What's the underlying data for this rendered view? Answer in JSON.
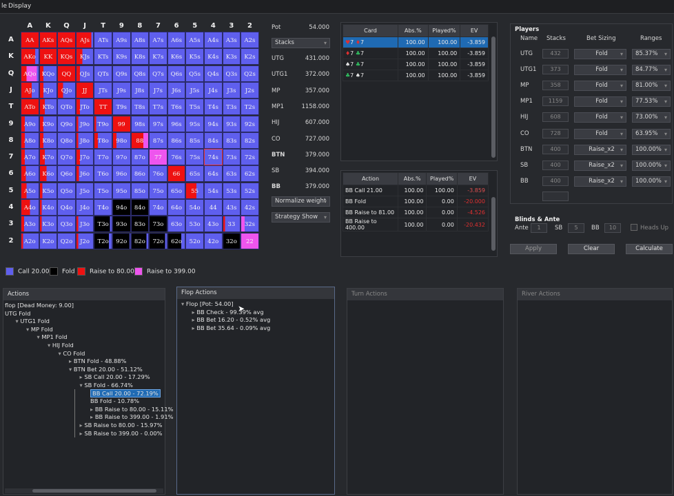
{
  "menu": {
    "file": "le",
    "display": "Display"
  },
  "ranks": [
    "A",
    "K",
    "Q",
    "J",
    "T",
    "9",
    "8",
    "7",
    "6",
    "5",
    "4",
    "3",
    "2"
  ],
  "cells": [
    [
      "AA",
      "AKs",
      "AQs",
      "AJs",
      "ATs",
      "A9s",
      "A8s",
      "A7s",
      "A6s",
      "A5s",
      "A4s",
      "A3s",
      "A2s"
    ],
    [
      "AKo",
      "KK",
      "KQs",
      "KJs",
      "KTs",
      "K9s",
      "K8s",
      "K7s",
      "K6s",
      "K5s",
      "K4s",
      "K3s",
      "K2s"
    ],
    [
      "AQo",
      "KQo",
      "QQ",
      "QJs",
      "QTs",
      "Q9s",
      "Q8s",
      "Q7s",
      "Q6s",
      "Q5s",
      "Q4s",
      "Q3s",
      "Q2s"
    ],
    [
      "AJo",
      "KJo",
      "QJo",
      "JJ",
      "JTs",
      "J9s",
      "J8s",
      "J7s",
      "J6s",
      "J5s",
      "J4s",
      "J3s",
      "J2s"
    ],
    [
      "ATo",
      "KTo",
      "QTo",
      "JTo",
      "TT",
      "T9s",
      "T8s",
      "T7s",
      "T6s",
      "T5s",
      "T4s",
      "T3s",
      "T2s"
    ],
    [
      "A9o",
      "K9o",
      "Q9o",
      "J9o",
      "T9o",
      "99",
      "98s",
      "97s",
      "96s",
      "95s",
      "94s",
      "93s",
      "92s"
    ],
    [
      "A8o",
      "K8o",
      "Q8o",
      "J8o",
      "T8o",
      "98o",
      "88",
      "87s",
      "86s",
      "85s",
      "84s",
      "83s",
      "82s"
    ],
    [
      "A7o",
      "K7o",
      "Q7o",
      "J7o",
      "T7o",
      "97o",
      "87o",
      "77",
      "76s",
      "75s",
      "74s",
      "73s",
      "72s"
    ],
    [
      "A6o",
      "K6o",
      "Q6o",
      "J6o",
      "T6o",
      "96o",
      "86o",
      "76o",
      "66",
      "65s",
      "64s",
      "63s",
      "62s"
    ],
    [
      "A5o",
      "K5o",
      "Q5o",
      "J5o",
      "T5o",
      "95o",
      "85o",
      "75o",
      "65o",
      "55",
      "54s",
      "53s",
      "52s"
    ],
    [
      "A4o",
      "K4o",
      "Q4o",
      "J4o",
      "T4o",
      "94o",
      "84o",
      "74o",
      "64o",
      "54o",
      "44",
      "43s",
      "42s"
    ],
    [
      "A3o",
      "K3o",
      "Q3o",
      "J3o",
      "T3o",
      "93o",
      "83o",
      "73o",
      "63o",
      "53o",
      "43o",
      "33",
      "32s"
    ],
    [
      "A2o",
      "K2o",
      "Q2o",
      "J2o",
      "T2o",
      "92o",
      "82o",
      "72o",
      "62o",
      "52o",
      "42o",
      "32o",
      "22"
    ]
  ],
  "colors": {
    "call": "#5f5fee",
    "fold": "#000000",
    "raise80": "#ee1111",
    "raise399": "#ee55ee"
  },
  "legend": [
    {
      "label": "Call 20.00",
      "color": "#5f5fee"
    },
    {
      "label": "Fold",
      "color": "#000000"
    },
    {
      "label": "Raise to 80.00",
      "color": "#ee1111"
    },
    {
      "label": "Raise to 399.00",
      "color": "#ee55ee"
    }
  ],
  "info": {
    "pot_label": "Pot",
    "pot_value": "54.000",
    "stacks_select": "Stacks",
    "players": [
      {
        "name": "UTG",
        "value": "431.000",
        "bold": false
      },
      {
        "name": "UTG1",
        "value": "372.000",
        "bold": false
      },
      {
        "name": "MP",
        "value": "357.000",
        "bold": false
      },
      {
        "name": "MP1",
        "value": "1158.000",
        "bold": false
      },
      {
        "name": "HIJ",
        "value": "607.000",
        "bold": false
      },
      {
        "name": "CO",
        "value": "727.000",
        "bold": false
      },
      {
        "name": "BTN",
        "value": "379.000",
        "bold": true
      },
      {
        "name": "SB",
        "value": "394.000",
        "bold": false
      },
      {
        "name": "BB",
        "value": "379.000",
        "bold": true
      }
    ],
    "normalize_select": "Normalize weight",
    "strategy_select": "Strategy Show"
  },
  "card_table": {
    "headers": [
      "Card",
      "Abs.%",
      "Played%",
      "EV"
    ],
    "rows": [
      {
        "card": "♥7 ♦7",
        "abs": "100.00",
        "played": "100.00",
        "ev": "-3.859"
      },
      {
        "card": "♦7 ♣7",
        "abs": "100.00",
        "played": "100.00",
        "ev": "-3.859"
      },
      {
        "card": "♠7 ♣7",
        "abs": "100.00",
        "played": "100.00",
        "ev": "-3.859"
      },
      {
        "card": "♣7 ♠7",
        "abs": "100.00",
        "played": "100.00",
        "ev": "-3.859"
      }
    ]
  },
  "action_table": {
    "headers": [
      "Action",
      "Abs.%",
      "Played%",
      "EV"
    ],
    "rows": [
      {
        "action": "BB Call 21.00",
        "abs": "100.00",
        "played": "100.00",
        "ev": "-3.859"
      },
      {
        "action": "BB Fold",
        "abs": "100.00",
        "played": "0.00",
        "ev": "-20.000"
      },
      {
        "action": "BB Raise to 81.00",
        "abs": "100.00",
        "played": "0.00",
        "ev": "-4.526"
      },
      {
        "action": "BB Raise to 400.00",
        "abs": "100.00",
        "played": "0.00",
        "ev": "-20.432"
      }
    ]
  },
  "players_panel": {
    "title": "Players",
    "headers": [
      "Name",
      "Stacks",
      "Bet Sizing",
      "Ranges"
    ],
    "rows": [
      {
        "name": "UTG",
        "stack": "432",
        "sizing": "Fold",
        "range": "85.37%"
      },
      {
        "name": "UTG1",
        "stack": "373",
        "sizing": "Fold",
        "range": "84.77%"
      },
      {
        "name": "MP",
        "stack": "358",
        "sizing": "Fold",
        "range": "81.00%"
      },
      {
        "name": "MP1",
        "stack": "1159",
        "sizing": "Fold",
        "range": "77.53%"
      },
      {
        "name": "HIJ",
        "stack": "608",
        "sizing": "Fold",
        "range": "73.00%"
      },
      {
        "name": "CO",
        "stack": "728",
        "sizing": "Fold",
        "range": "63.95%"
      },
      {
        "name": "BTN",
        "stack": "400",
        "sizing": "Raise_x2",
        "range": "100.00%"
      },
      {
        "name": "SB",
        "stack": "400",
        "sizing": "Raise_x2",
        "range": "100.00%"
      },
      {
        "name": "BB",
        "stack": "400",
        "sizing": "Raise_x2",
        "range": "100.00%"
      }
    ]
  },
  "blinds": {
    "title": "Blinds & Ante",
    "ante_label": "Ante",
    "ante": "1",
    "sb_label": "SB",
    "sb": "5",
    "bb_label": "BB",
    "bb": "10",
    "heads_up": "Heads Up"
  },
  "buttons": {
    "apply": "Apply",
    "clear": "Clear",
    "calculate": "Calculate"
  },
  "actions_panel": {
    "title": "Actions",
    "items": [
      {
        "text": "flop [Dead Money: 9.00]",
        "depth": 0,
        "arrow": ""
      },
      {
        "text": "UTG Fold",
        "depth": 0,
        "arrow": ""
      },
      {
        "text": "UTG1 Fold",
        "depth": 1,
        "arrow": "▾"
      },
      {
        "text": "MP Fold",
        "depth": 2,
        "arrow": "▾"
      },
      {
        "text": "MP1 Fold",
        "depth": 3,
        "arrow": "▾"
      },
      {
        "text": "HIJ Fold",
        "depth": 4,
        "arrow": "▾"
      },
      {
        "text": "CO Fold",
        "depth": 5,
        "arrow": "▾"
      },
      {
        "text": "BTN Fold - 48.88%",
        "depth": 6,
        "arrow": "▸"
      },
      {
        "text": "BTN Bet 20.00 - 51.12%",
        "depth": 6,
        "arrow": "▾"
      },
      {
        "text": "SB Call 20.00 - 17.29%",
        "depth": 7,
        "arrow": "▸"
      },
      {
        "text": "SB Fold - 66.74%",
        "depth": 7,
        "arrow": "▾"
      },
      {
        "text": "BB Call 20.00 - 72.19%",
        "depth": 8,
        "arrow": "",
        "selected": true
      },
      {
        "text": "BB Fold - 10.78%",
        "depth": 8,
        "arrow": ""
      },
      {
        "text": "BB Raise to 80.00 - 15.11%",
        "depth": 8,
        "arrow": "▸"
      },
      {
        "text": "BB Raise to 399.00 - 1.91%",
        "depth": 8,
        "arrow": "▸"
      },
      {
        "text": "SB Raise to 80.00 - 15.97%",
        "depth": 7,
        "arrow": "▸"
      },
      {
        "text": "SB Raise to 399.00 - 0.00%",
        "depth": 7,
        "arrow": "▸"
      }
    ]
  },
  "flop_panel": {
    "title": "Flop Actions",
    "items": [
      {
        "text": "Flop [Pot: 54.00]",
        "depth": 0,
        "arrow": "▾"
      },
      {
        "text": "BB Check - 99.39% avg",
        "depth": 1,
        "arrow": "▸"
      },
      {
        "text": "BB Bet 16.20 - 0.52% avg",
        "depth": 1,
        "arrow": "▸"
      },
      {
        "text": "BB Bet 35.64 - 0.09% avg",
        "depth": 1,
        "arrow": "▸"
      }
    ]
  },
  "turn_panel": {
    "title": "Turn Actions"
  },
  "river_panel": {
    "title": "River Actions"
  }
}
